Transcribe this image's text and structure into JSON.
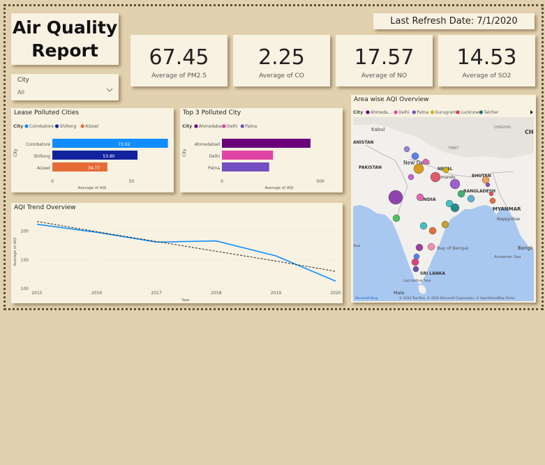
{
  "header": {
    "title_line1": "Air Quality",
    "title_line2": "Report",
    "refresh": "Last Refresh Date: 7/1/2020"
  },
  "kpis": [
    {
      "value": "67.45",
      "label": "Average of PM2.5"
    },
    {
      "value": "2.25",
      "label": "Average of CO"
    },
    {
      "value": "17.57",
      "label": "Average of NO"
    },
    {
      "value": "14.53",
      "label": "Average of SO2"
    }
  ],
  "slicer": {
    "label": "City",
    "value": "All"
  },
  "least_polluted": {
    "title": "Lease Polluted Cities",
    "legend_title": "City",
    "legend": [
      {
        "name": "Coimbatore",
        "color": "#118dff"
      },
      {
        "name": "Shillong",
        "color": "#12239e"
      },
      {
        "name": "Aizawl",
        "color": "#e66c37"
      }
    ],
    "chart_data": {
      "type": "bar",
      "categories": [
        "Coimbatore",
        "Shillong",
        "Aizawl"
      ],
      "values": [
        73.02,
        53.8,
        34.77
      ],
      "value_labels": [
        "73.02",
        "53.80",
        "34.77"
      ],
      "colors": [
        "#118dff",
        "#12239e",
        "#e66c37"
      ],
      "xlabel": "Average of AQI",
      "ylabel": "City",
      "xticks": [
        "0",
        "50"
      ],
      "xlim": [
        0,
        82
      ]
    }
  },
  "top_polluted": {
    "title": "Top 3 Polluted City",
    "legend_title": "City",
    "legend": [
      {
        "name": "Ahmedabad",
        "color": "#6b007b"
      },
      {
        "name": "Delhi",
        "color": "#e044a7"
      },
      {
        "name": "Patna",
        "color": "#744ec2"
      }
    ],
    "chart_data": {
      "type": "bar",
      "categories": [
        "Ahmedabad",
        "Delhi",
        "Patna"
      ],
      "values": [
        450,
        260,
        240
      ],
      "colors": [
        "#6b007b",
        "#e044a7",
        "#744ec2"
      ],
      "xlabel": "Average of AQI",
      "ylabel": "City",
      "xticks": [
        "0",
        "500"
      ],
      "xlim": [
        0,
        560
      ]
    }
  },
  "trend": {
    "title": "AQI Trend Overview",
    "chart_data": {
      "type": "line",
      "x": [
        2015,
        2016,
        2017,
        2018,
        2019,
        2020
      ],
      "x_labels": [
        "2015",
        "2016",
        "2017",
        "2018",
        "2019",
        "2020"
      ],
      "series": [
        {
          "values": [
            212,
            198,
            181,
            183,
            157,
            113
          ],
          "color": "#118dff"
        }
      ],
      "trendline": [
        217,
        199,
        182,
        165,
        148,
        130
      ],
      "yticks": [
        "100",
        "150",
        "200"
      ],
      "ylim": [
        100,
        225
      ],
      "xlabel": "Year",
      "ylabel": "Average of AQI"
    }
  },
  "map": {
    "title": "Area wise AQI Overview",
    "legend_title": "City",
    "legend": [
      {
        "name": "Ahmeda...",
        "color": "#6b007b"
      },
      {
        "name": "Delhi",
        "color": "#e044a7"
      },
      {
        "name": "Patna",
        "color": "#744ec2"
      },
      {
        "name": "Gurugram",
        "color": "#d9b300"
      },
      {
        "name": "Lucknow",
        "color": "#d64550"
      },
      {
        "name": "Talcher",
        "color": "#197278"
      }
    ],
    "labels": [
      "Kabul",
      "PAKISTAN",
      "ANISTAN",
      "TIBET",
      "QINGHAI",
      "CH",
      "New Delhi",
      "NEPAL",
      "Kathmandu",
      "BHUTAN",
      "BANGLADESH",
      "INDIA",
      "MYANMAR",
      "Naypyidaw",
      "Bay of Bengal",
      "Andaman Sea",
      "Bangk",
      "SRI LANKA",
      "Laccadive Sea",
      "Male",
      "Sea"
    ],
    "attribution": "© 2024 TomTom, © 2024 Microsoft Corporation, © OpenStreetMap Terms",
    "brand": "Microsoft Bing"
  }
}
